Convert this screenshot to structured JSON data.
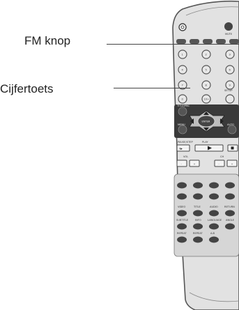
{
  "labels": {
    "fm_knop": "FM knop",
    "cijfertoets": "Cijfertoets"
  },
  "remote": {
    "top_right_button": "MUTE",
    "number_keys": [
      "1",
      "2",
      "3",
      "4",
      "5",
      "6",
      "7",
      "8",
      "9",
      "0",
      "10+"
    ],
    "setup_label": "SETUP",
    "nav_top_left": "TITLE/PBC",
    "nav_center": "ENTER",
    "nav_bottom_left": "MENU",
    "nav_right": "AUTO",
    "transport_left_label": "PAUSE/STEP",
    "transport_center_label": "PLAY",
    "transport_right_label": "STOP",
    "vol_label": "VOL",
    "ch_label": "CH",
    "grid_row1": [
      "VIDEO",
      "TITLE",
      "AUDIO",
      "RETURN"
    ],
    "grid_row2": [
      "SUBTITLE",
      "INFO",
      "LANGUAGE",
      "ANGLE"
    ],
    "grid_row3": [
      "REPEAT",
      "REPEAT",
      "A-B",
      ""
    ]
  },
  "colors": {
    "body": "#e2e2e2",
    "outline": "#555555",
    "panel": "#3a3a3a",
    "button_dark": "#444444",
    "button_light": "#f4f4f4"
  }
}
